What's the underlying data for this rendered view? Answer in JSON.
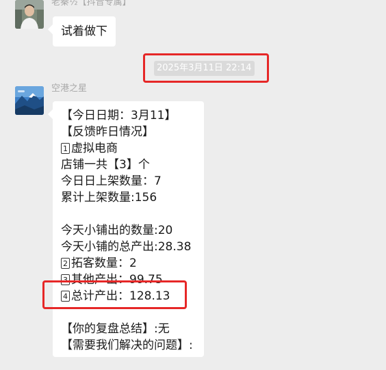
{
  "messages": [
    {
      "sender": "老秦½【抖音专属】",
      "text": "试着做下"
    },
    {
      "sender": "空港之星",
      "lines": [
        {
          "text": "【今日日期：3月11】"
        },
        {
          "text": "【反馈昨日情况】"
        },
        {
          "badge": "1",
          "text": "虚拟电商"
        },
        {
          "text": "店铺一共【3】个"
        },
        {
          "text": "今日日上架数量：7"
        },
        {
          "text": "累计上架数量:156"
        },
        {
          "text": ""
        },
        {
          "text": "今天小铺出的数量:20"
        },
        {
          "text": "今天小铺的总产出:28.38"
        },
        {
          "badge": "2",
          "text": "拓客数量：2"
        },
        {
          "badge": "3",
          "text": "其他产出：99.75"
        },
        {
          "badge": "4",
          "text": "总计产出：128.13"
        },
        {
          "text": ""
        },
        {
          "text": "【你的复盘总结】:无"
        },
        {
          "text": "【需要我们解决的问题】:"
        }
      ]
    }
  ],
  "timestamp": "2025年3月11日 22:14",
  "colors": {
    "background": "#ededed",
    "bubble": "#ffffff",
    "highlight": "#e62727",
    "timestamp_bg": "#dadada",
    "sender_name": "#a8a8a8"
  },
  "icons": {
    "avatar_1": "person-photo-avatar",
    "avatar_2": "mountain-landscape-avatar"
  }
}
